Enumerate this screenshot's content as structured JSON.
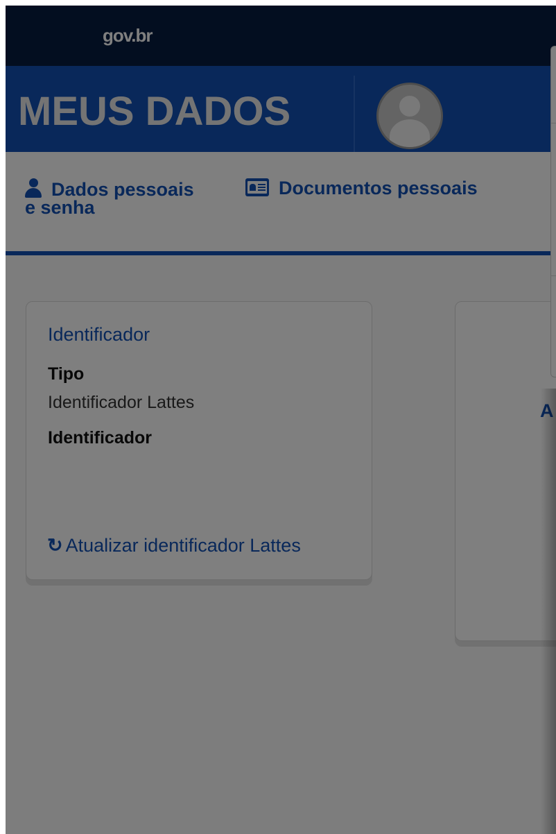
{
  "topbar": {
    "brand": "gov.br"
  },
  "header": {
    "title": "MEUS DADOS"
  },
  "nav": {
    "items": [
      {
        "label_line1": "Dados pessoais",
        "label_line2": "e senha",
        "icon": "user-icon"
      },
      {
        "label": "Documentos pessoais",
        "icon": "id-card-icon"
      }
    ]
  },
  "card_identificador": {
    "title": "Identificador",
    "fields": [
      {
        "label": "Tipo",
        "value": "Identificador Lattes"
      },
      {
        "label": "Identificador",
        "value": ""
      }
    ],
    "action": {
      "label": "Atualizar identificador Lattes",
      "icon": "refresh-icon"
    }
  },
  "card_second": {
    "visible_text": "A"
  },
  "colors": {
    "govbar": "#071d41",
    "primary": "#1351b4",
    "overlay": "rgba(0,0,0,0.5)"
  }
}
